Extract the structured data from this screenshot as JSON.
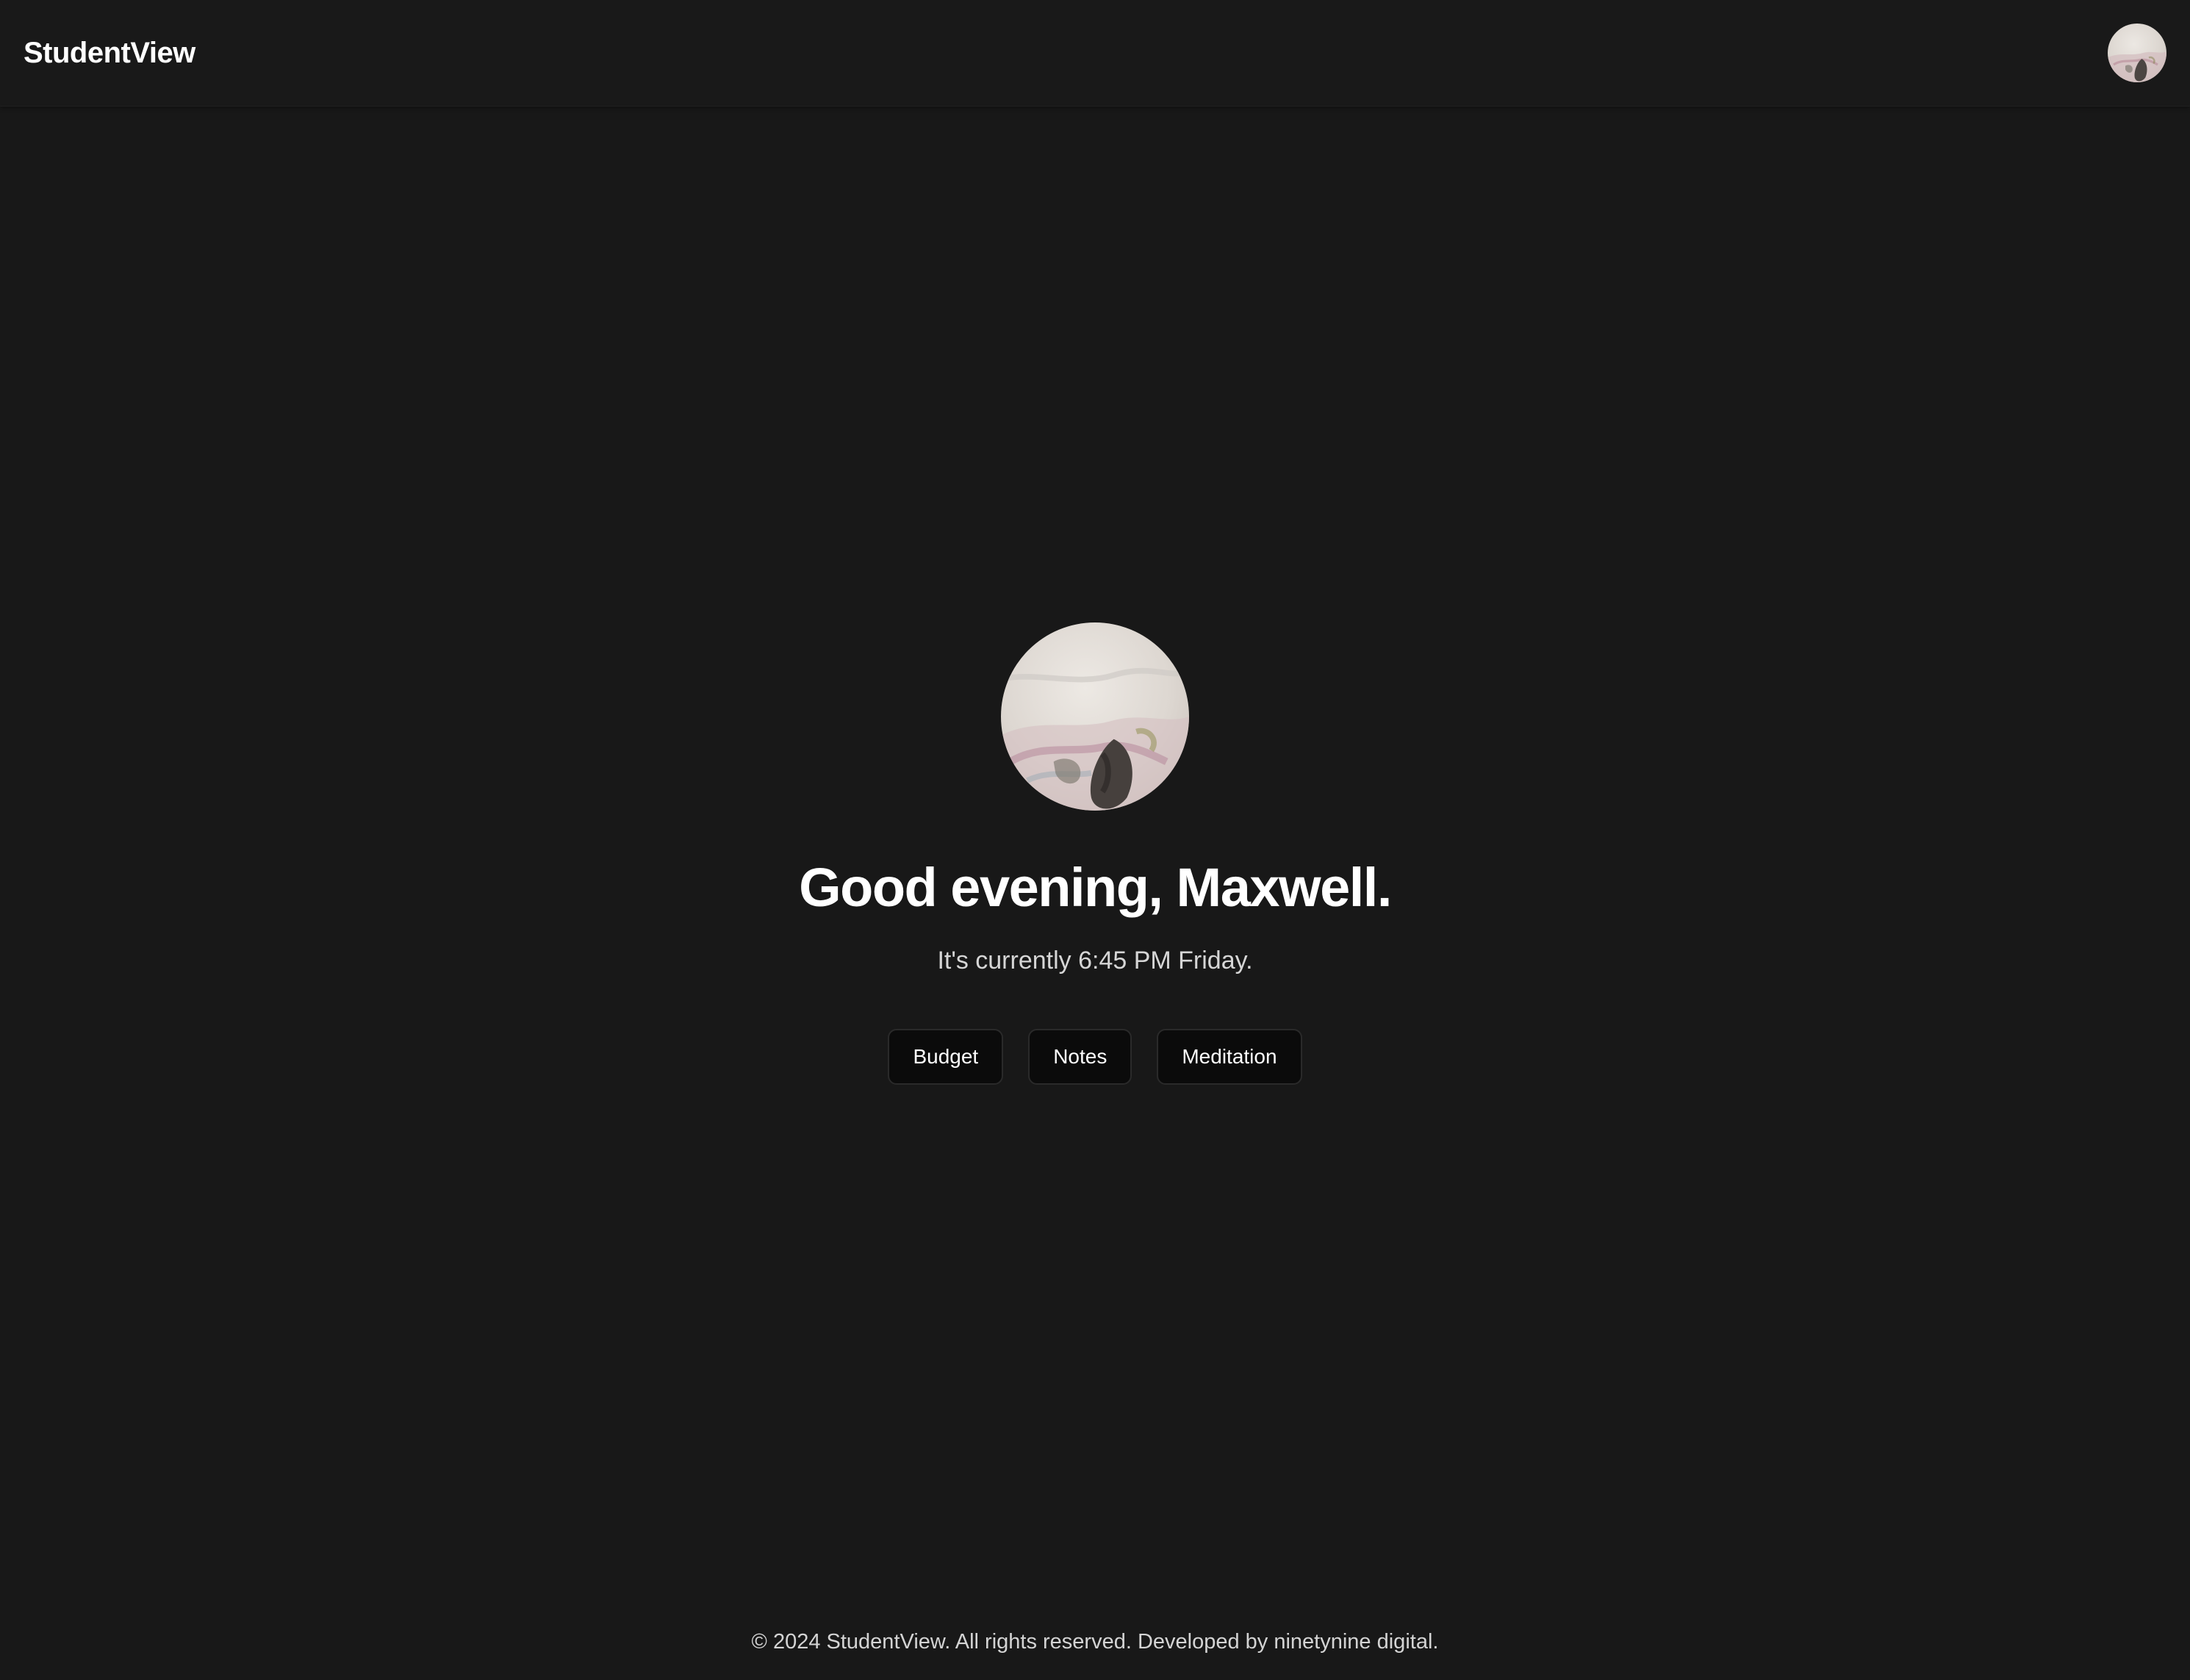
{
  "header": {
    "brand": "StudentView",
    "profile_avatar_icon": "user-avatar"
  },
  "hero": {
    "avatar_icon": "user-avatar",
    "greeting": "Good evening, Maxwell.",
    "subtitle": "It's currently 6:45 PM Friday."
  },
  "actions": [
    {
      "label": "Budget"
    },
    {
      "label": "Notes"
    },
    {
      "label": "Meditation"
    }
  ],
  "footer": {
    "text": "© 2024 StudentView. All rights reserved. Developed by ninetynine digital."
  },
  "colors": {
    "background": "#181818",
    "button_background": "#0b0b0b",
    "button_border": "#2a2a2a",
    "text_primary": "#ffffff",
    "text_secondary": "#d6d6d6"
  }
}
